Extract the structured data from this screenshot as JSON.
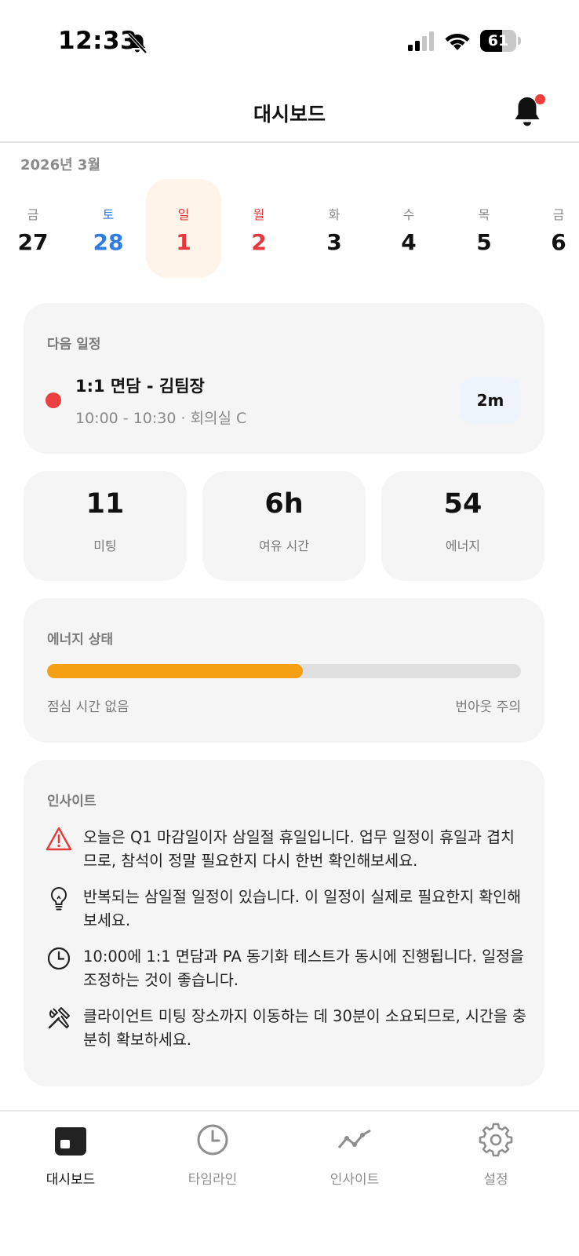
{
  "status_bar": {
    "time": "12:33",
    "battery": "61",
    "battery_level": 0.61,
    "icons": [
      "bell-slash-icon",
      "signal-icon",
      "wifi-icon",
      "battery-icon"
    ]
  },
  "header": {
    "title": "대시보드",
    "notification_icon": "bell-icon",
    "has_unread": true
  },
  "calendar": {
    "month_label": "2026년 3월",
    "days": [
      {
        "name": "금",
        "num": "27",
        "color": "normal"
      },
      {
        "name": "토",
        "num": "28",
        "color": "blue"
      },
      {
        "name": "일",
        "num": "1",
        "color": "red",
        "selected": true
      },
      {
        "name": "월",
        "num": "2",
        "color": "red"
      },
      {
        "name": "화",
        "num": "3",
        "color": "normal"
      },
      {
        "name": "수",
        "num": "4",
        "color": "normal"
      },
      {
        "name": "목",
        "num": "5",
        "color": "normal"
      },
      {
        "name": "금",
        "num": "6",
        "color": "normal"
      }
    ]
  },
  "next_event": {
    "label": "다음 일정",
    "title": "1:1 면담 - 김팀장",
    "details": "10:00 - 10:30 · 회의실 C",
    "badge": "2m",
    "dot_color": "#ea4040"
  },
  "stats": [
    {
      "value": "11",
      "label": "미팅"
    },
    {
      "value": "6h",
      "label": "여유 시간"
    },
    {
      "value": "54",
      "label": "에너지"
    }
  ],
  "energy": {
    "label": "에너지 상태",
    "level": 0.54,
    "left_text": "점심 시간 없음",
    "right_text": "번아웃 주의",
    "bar_color": "#f4a012"
  },
  "insights": {
    "label": "인사이트",
    "items": [
      {
        "icon": "warning-icon",
        "text": "오늘은 Q1 마감일이자 삼일절 휴일입니다. 업무 일정이 휴일과 겹치므로, 참석이 정말 필요한지 다시 한번 확인해보세요."
      },
      {
        "icon": "lightbulb-icon",
        "text": "반복되는 삼일절 일정이 있습니다. 이 일정이 실제로 필요한지 확인해보세요."
      },
      {
        "icon": "clock-icon",
        "text": "10:00에 1:1 면담과 PA 동기화 테스트가 동시에 진행됩니다. 일정을 조정하는 것이 좋습니다."
      },
      {
        "icon": "tools-icon",
        "text": "클라이언트 미팅 장소까지 이동하는 데 30분이 소요되므로, 시간을 충분히 확보하세요."
      }
    ]
  },
  "tabbar": {
    "tabs": [
      {
        "label": "대시보드",
        "icon": "calendar-icon",
        "active": true
      },
      {
        "label": "타임라인",
        "icon": "clock-icon",
        "active": false
      },
      {
        "label": "인사이트",
        "icon": "chart-line-icon",
        "active": false
      },
      {
        "label": "설정",
        "icon": "gear-icon",
        "active": false
      }
    ]
  }
}
